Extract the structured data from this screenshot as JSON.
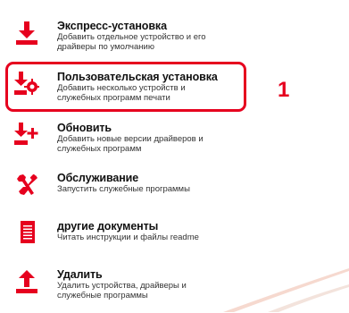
{
  "accent_color": "#e6001e",
  "menu": {
    "items": [
      {
        "icon": "download-icon",
        "title": "Экспресс-установка",
        "desc1": "Добавить отдельное устройство и его",
        "desc2": "драйверы по умолчанию"
      },
      {
        "icon": "download-settings-icon",
        "title": "Пользовательская установка",
        "desc1": "Добавить несколько устройств и",
        "desc2": "служебных программ печати",
        "highlighted": true
      },
      {
        "icon": "download-plus-icon",
        "title": "Обновить",
        "desc1": "Добавить новые версии драйверов и",
        "desc2": "служебных программ"
      },
      {
        "icon": "tools-icon",
        "title": "Обслуживание",
        "desc1": "Запустить служебные программы",
        "desc2": ""
      },
      {
        "icon": "document-icon",
        "title": "другие документы",
        "desc1": "Читать инструкции и файлы readme",
        "desc2": ""
      },
      {
        "icon": "upload-icon",
        "title": "Удалить",
        "desc1": "Удалить устройства, драйверы и",
        "desc2": "служебные программы"
      }
    ]
  },
  "callout": {
    "label": "1"
  }
}
